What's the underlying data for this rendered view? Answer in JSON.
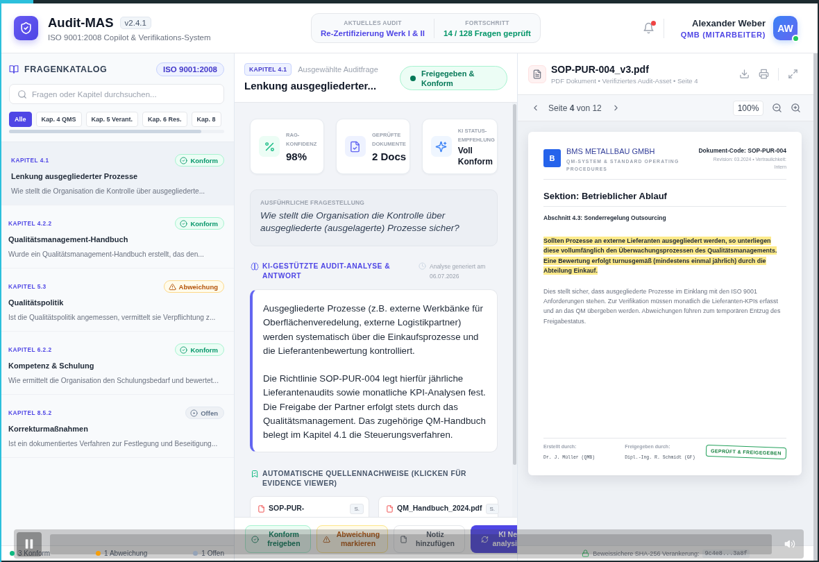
{
  "header": {
    "title": "Audit-MAS",
    "version": "v2.4.1",
    "subtitle": "ISO 9001:2008 Copilot & Verifikations-System",
    "audit_info": [
      {
        "label": "AKTUELLES AUDIT",
        "value": "Re-Zertifizierung Werk I & II",
        "kind": "audit"
      },
      {
        "label": "FORTSCHRITT",
        "value": "14 / 128 Fragen geprüft",
        "kind": "progress"
      }
    ],
    "notifications": {
      "unread": true
    },
    "user": {
      "name": "Alexander Weber",
      "role": "QMB (MITARBEITER)",
      "initials": "AW",
      "online": true
    }
  },
  "sidebar": {
    "title": "FRAGENKATALOG",
    "standard": "ISO 9001:2008",
    "search": {
      "placeholder": "Fragen oder Kapitel durchsuchen..."
    },
    "filters": [
      {
        "label": "Alle",
        "selected": true
      },
      {
        "label": "Kap. 4 QMS",
        "selected": false
      },
      {
        "label": "Kap. 5 Verant.",
        "selected": false
      },
      {
        "label": "Kap. 6 Res.",
        "selected": false
      },
      {
        "label": "Kap. 8",
        "selected": false
      }
    ],
    "questions": [
      {
        "chapter": "KAPITEL 4.1",
        "status": "Konform",
        "kind": "konform",
        "title": "Lenkung ausgegliederter Prozesse",
        "description": "Wie stellt die Organisation die Kontrolle über ausgegliederte...",
        "selected": true
      },
      {
        "chapter": "KAPITEL 4.2.2",
        "status": "Konform",
        "kind": "konform",
        "title": "Qualitätsmanagement-Handbuch",
        "description": "Wurde ein Qualitätsmanagement-Handbuch erstellt, das den...",
        "selected": false
      },
      {
        "chapter": "KAPITEL 5.3",
        "status": "Abweichung",
        "kind": "abweichung",
        "title": "Qualitätspolitik",
        "description": "Ist die Qualitätspolitik angemessen, vermittelt sie Verpflichtung z...",
        "selected": false
      },
      {
        "chapter": "KAPITEL 6.2.2",
        "status": "Konform",
        "kind": "konform",
        "title": "Kompetenz & Schulung",
        "description": "Wie ermittelt die Organisation den Schulungsbedarf und bewertet...",
        "selected": false
      },
      {
        "chapter": "KAPITEL 8.5.2",
        "status": "Offen",
        "kind": "offen",
        "title": "Korrekturmaßnahmen",
        "description": "Ist ein dokumentiertes Verfahren zur Festlegung und Beseitigung...",
        "selected": false
      }
    ],
    "summary": [
      {
        "label": "3 Konform",
        "color": "#10b981"
      },
      {
        "label": "1 Abweichung",
        "color": "#f59e0b"
      },
      {
        "label": "1 Offen",
        "color": "#94a3b8"
      }
    ]
  },
  "detail": {
    "chapter": "KAPITEL 4.1",
    "caption": "Ausgewählte Auditfrage",
    "title": "Lenkung ausgegliederter...",
    "status": {
      "label": "Freigegeben & Konform",
      "kind": "approved"
    },
    "stats": [
      {
        "label": "RAG-KONFIDENZ",
        "value": "98%",
        "kind": "confidence"
      },
      {
        "label": "GEPRÜFTE DOKUMENTE",
        "value": "2 Docs",
        "kind": "documents"
      },
      {
        "label": "KI STATUS-EMPFEHLUNG",
        "value": "Voll Konform",
        "kind": "recommendation"
      }
    ],
    "question": {
      "label": "AUSFÜHRLICHE FRAGESTELLUNG",
      "text": "Wie stellt die Organisation die Kontrolle über ausgegliederte (ausgelagerte) Prozesse sicher?"
    },
    "analysis": {
      "title": "KI-GESTÜTZTE AUDIT-ANALYSE & ANTWORT",
      "generated": "Analyse generiert am 06.07.2026",
      "paragraphs": [
        "Ausgegliederte Prozesse (z.B. externe Werkbänke für Oberflächenveredelung, externe Logistikpartner) werden systematisch über die Einkaufsprozesse und die Lieferantenbewertung kontrolliert.",
        "Die Richtlinie SOP-PUR-004 legt hierfür jährliche Lieferantenaudits sowie monatliche KPI-Analysen fest. Die Freigabe der Partner erfolgt stets durch das Qualitätsmanagement. Das zugehörige QM-Handbuch belegt im Kapitel 4.1 die Steuerungsverfahren."
      ]
    },
    "sources": {
      "title": "AUTOMATISCHE QUELLENNACHWEISE (KLICKEN FÜR EVIDENCE VIEWER)",
      "items": [
        {
          "name": "SOP-PUR-",
          "page": "S."
        },
        {
          "name": "QM_Handbuch_2024.pdf",
          "page": "S."
        }
      ]
    },
    "actions": [
      {
        "label": "Konform freigeben",
        "kind": "approve"
      },
      {
        "label": "Abweichung markieren",
        "kind": "deviation"
      },
      {
        "label": "Notiz hinzufügen",
        "kind": "note"
      },
      {
        "label": "KI Ne analysi",
        "kind": "ai"
      }
    ]
  },
  "viewer": {
    "file_name": "SOP-PUR-004_v3.pdf",
    "file_meta": "PDF Dokument • Verifiziertes Audit-Asset • Seite 4",
    "page_label": "Seite **4** von 12",
    "zoom": "100%",
    "document": {
      "company_initial": "B",
      "company": "BMS METALLBAU GMBH",
      "company_tagline": "QM-SYSTEM & STANDARD OPERATING PROCEDURES",
      "code": "Dokument-Code: SOP-PUR-004",
      "revision": "Revision: 03.2024 • Vertraulichkeit: Intern",
      "section": "Sektion: Betrieblicher Ablauf",
      "subsection": "Abschnitt 4.3: Sonderregelung Outsourcing",
      "paragraphs": [
        {
          "text": "Sollten Prozesse an externe Lieferanten ausgegliedert werden, so unterliegen diese vollumfänglich den Überwachungsprozessen des Qualitätsmanagements. Eine Bewertung erfolgt turnusgemäß (mindestens einmal jährlich) durch die Abteilung Einkauf.",
          "highlighted": true
        },
        {
          "text": "Dies stellt sicher, dass ausgegliederte Prozesse im Einklang mit den ISO 9001 Anforderungen stehen. Zur Verifikation müssen monatlich die Lieferanten-KPIs erfasst und an das QM übergeben werden. Abweichungen führen zum temporären Entzug des Freigabestatus.",
          "highlighted": false
        }
      ],
      "signatures": [
        {
          "label": "Erstellt durch:",
          "name": "Dr. J. Müller (QMB)"
        },
        {
          "label": "Freigegeben durch:",
          "name": "Dipl.-Ing. R. Schmidt (GF)"
        }
      ],
      "stamp": "GEPRÜFT & FREIGEGEBEN"
    },
    "footer": {
      "label": "Beweissichere SHA-256 Verankerung:",
      "hash": "9c4e8...3a8f"
    }
  },
  "video_player": {
    "playing": true
  }
}
